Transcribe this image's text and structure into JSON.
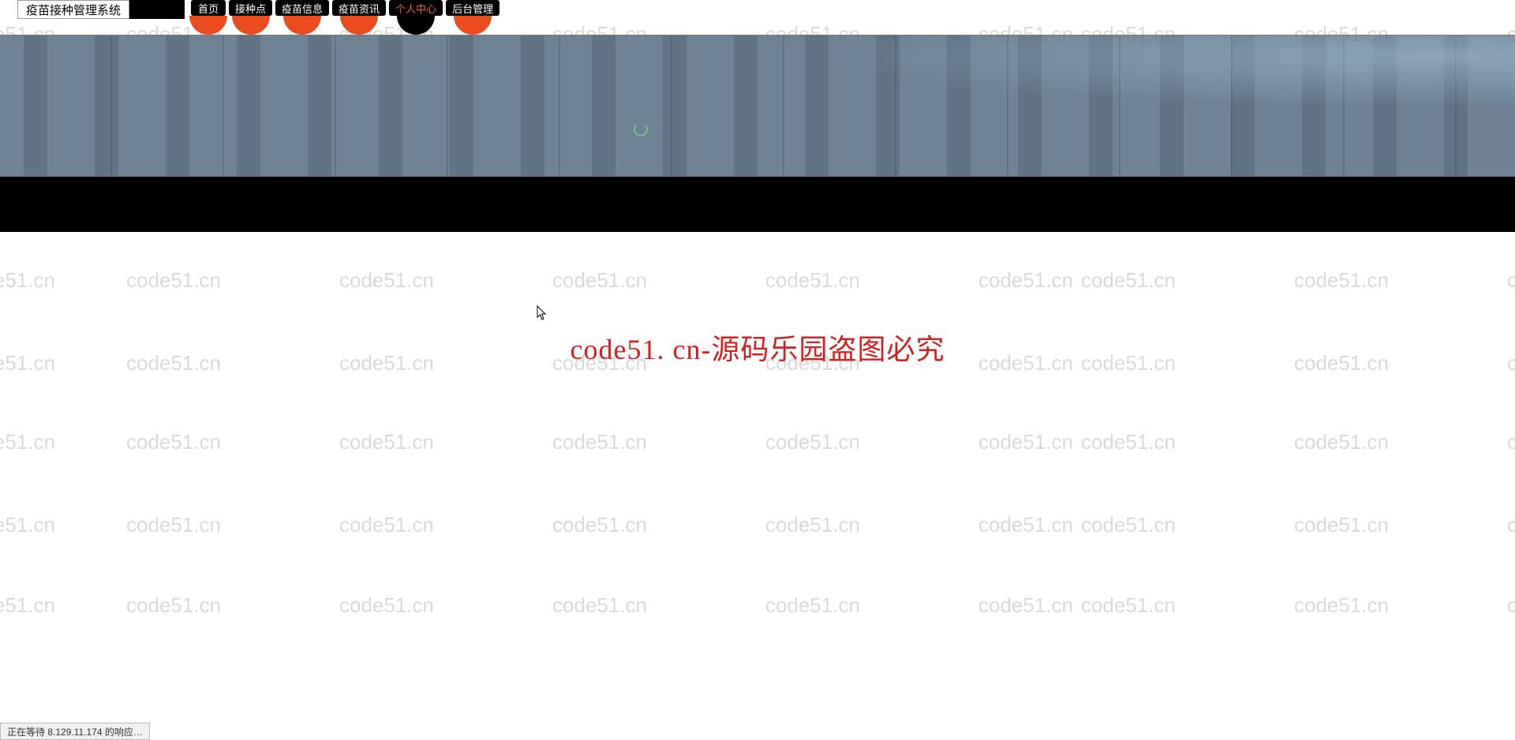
{
  "site_title": "疫苗接种管理系统",
  "nav": [
    {
      "label": "首页",
      "active": false,
      "lobe": "orange"
    },
    {
      "label": "接种点",
      "active": false,
      "lobe": "orange"
    },
    {
      "label": "疫苗信息",
      "active": false,
      "lobe": "orange"
    },
    {
      "label": "疫苗资讯",
      "active": false,
      "lobe": "orange"
    },
    {
      "label": "个人中心",
      "active": true,
      "lobe": "black"
    },
    {
      "label": "后台管理",
      "active": false,
      "lobe": "orange"
    }
  ],
  "center_message": "code51. cn-源码乐园盗图必究",
  "watermark_text": "code51.cn",
  "status_bar": "正在等待 8.129.11.174 的响应…"
}
